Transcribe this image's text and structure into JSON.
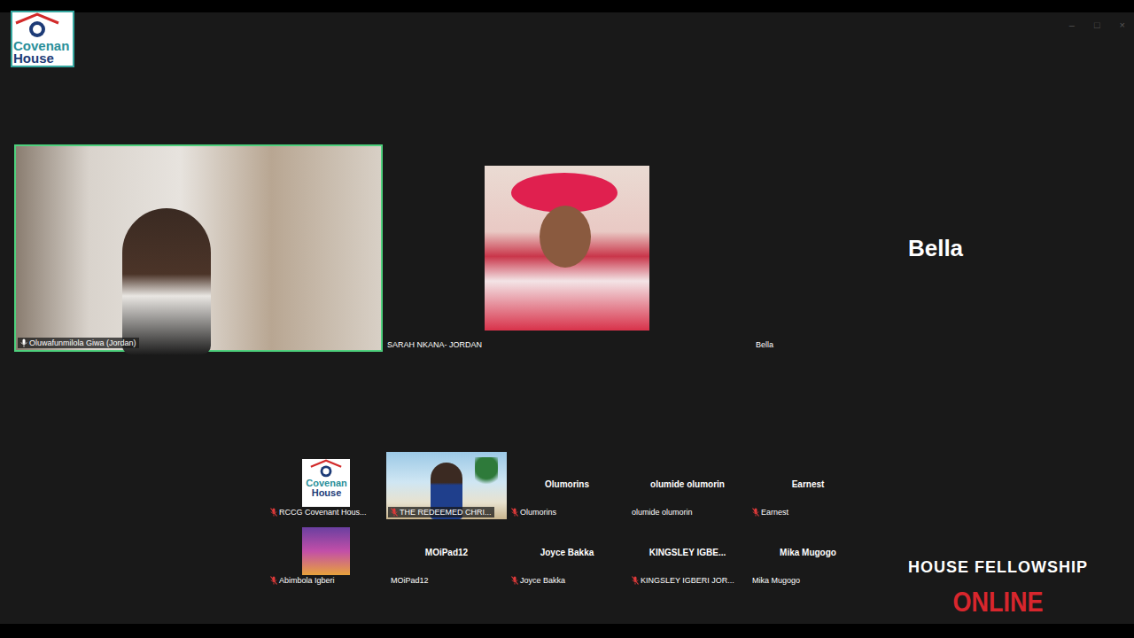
{
  "window": {
    "controls": [
      "–",
      "□",
      "×"
    ]
  },
  "logo": {
    "line1": "Covenan",
    "line2": "House"
  },
  "main_tiles": [
    {
      "name": "Oluwafunmilola Giwa  (Jordan)",
      "kind": "video",
      "speaking": true,
      "audio": "on"
    },
    {
      "name": "SARAH NKANA- JORDAN",
      "kind": "photo",
      "speaking": false,
      "audio": "none"
    },
    {
      "name": "Bella",
      "display": "Bella",
      "kind": "name",
      "speaking": false,
      "audio": "none"
    }
  ],
  "small_tiles": [
    {
      "name": "RCCG Covenant Hous...",
      "kind": "logo",
      "audio": "muted"
    },
    {
      "name": "THE REDEEMED CHRI...",
      "kind": "video",
      "audio": "muted"
    },
    {
      "name": "Olumorins",
      "display": "Olumorins",
      "kind": "name",
      "audio": "muted"
    },
    {
      "name": "olumide olumorin",
      "display": "olumide olumorin",
      "kind": "name",
      "audio": "none"
    },
    {
      "name": "Earnest",
      "display": "Earnest",
      "kind": "name",
      "audio": "muted"
    },
    {
      "name": "Abimbola Igberi",
      "kind": "photo",
      "audio": "muted"
    },
    {
      "name": "MOiPad12",
      "display": "MOiPad12",
      "kind": "name",
      "audio": "none"
    },
    {
      "name": "Joyce Bakka",
      "display": "Joyce Bakka",
      "kind": "name",
      "audio": "muted"
    },
    {
      "name": "KINGSLEY IGBERI JOR...",
      "display": "KINGSLEY IGBE...",
      "kind": "name",
      "audio": "muted"
    },
    {
      "name": "Mika Mugogo",
      "display": "Mika Mugogo",
      "kind": "name",
      "audio": "none"
    }
  ],
  "overlay": {
    "line1": "HOUSE FELLOWSHIP",
    "line2": "ONLINE"
  }
}
